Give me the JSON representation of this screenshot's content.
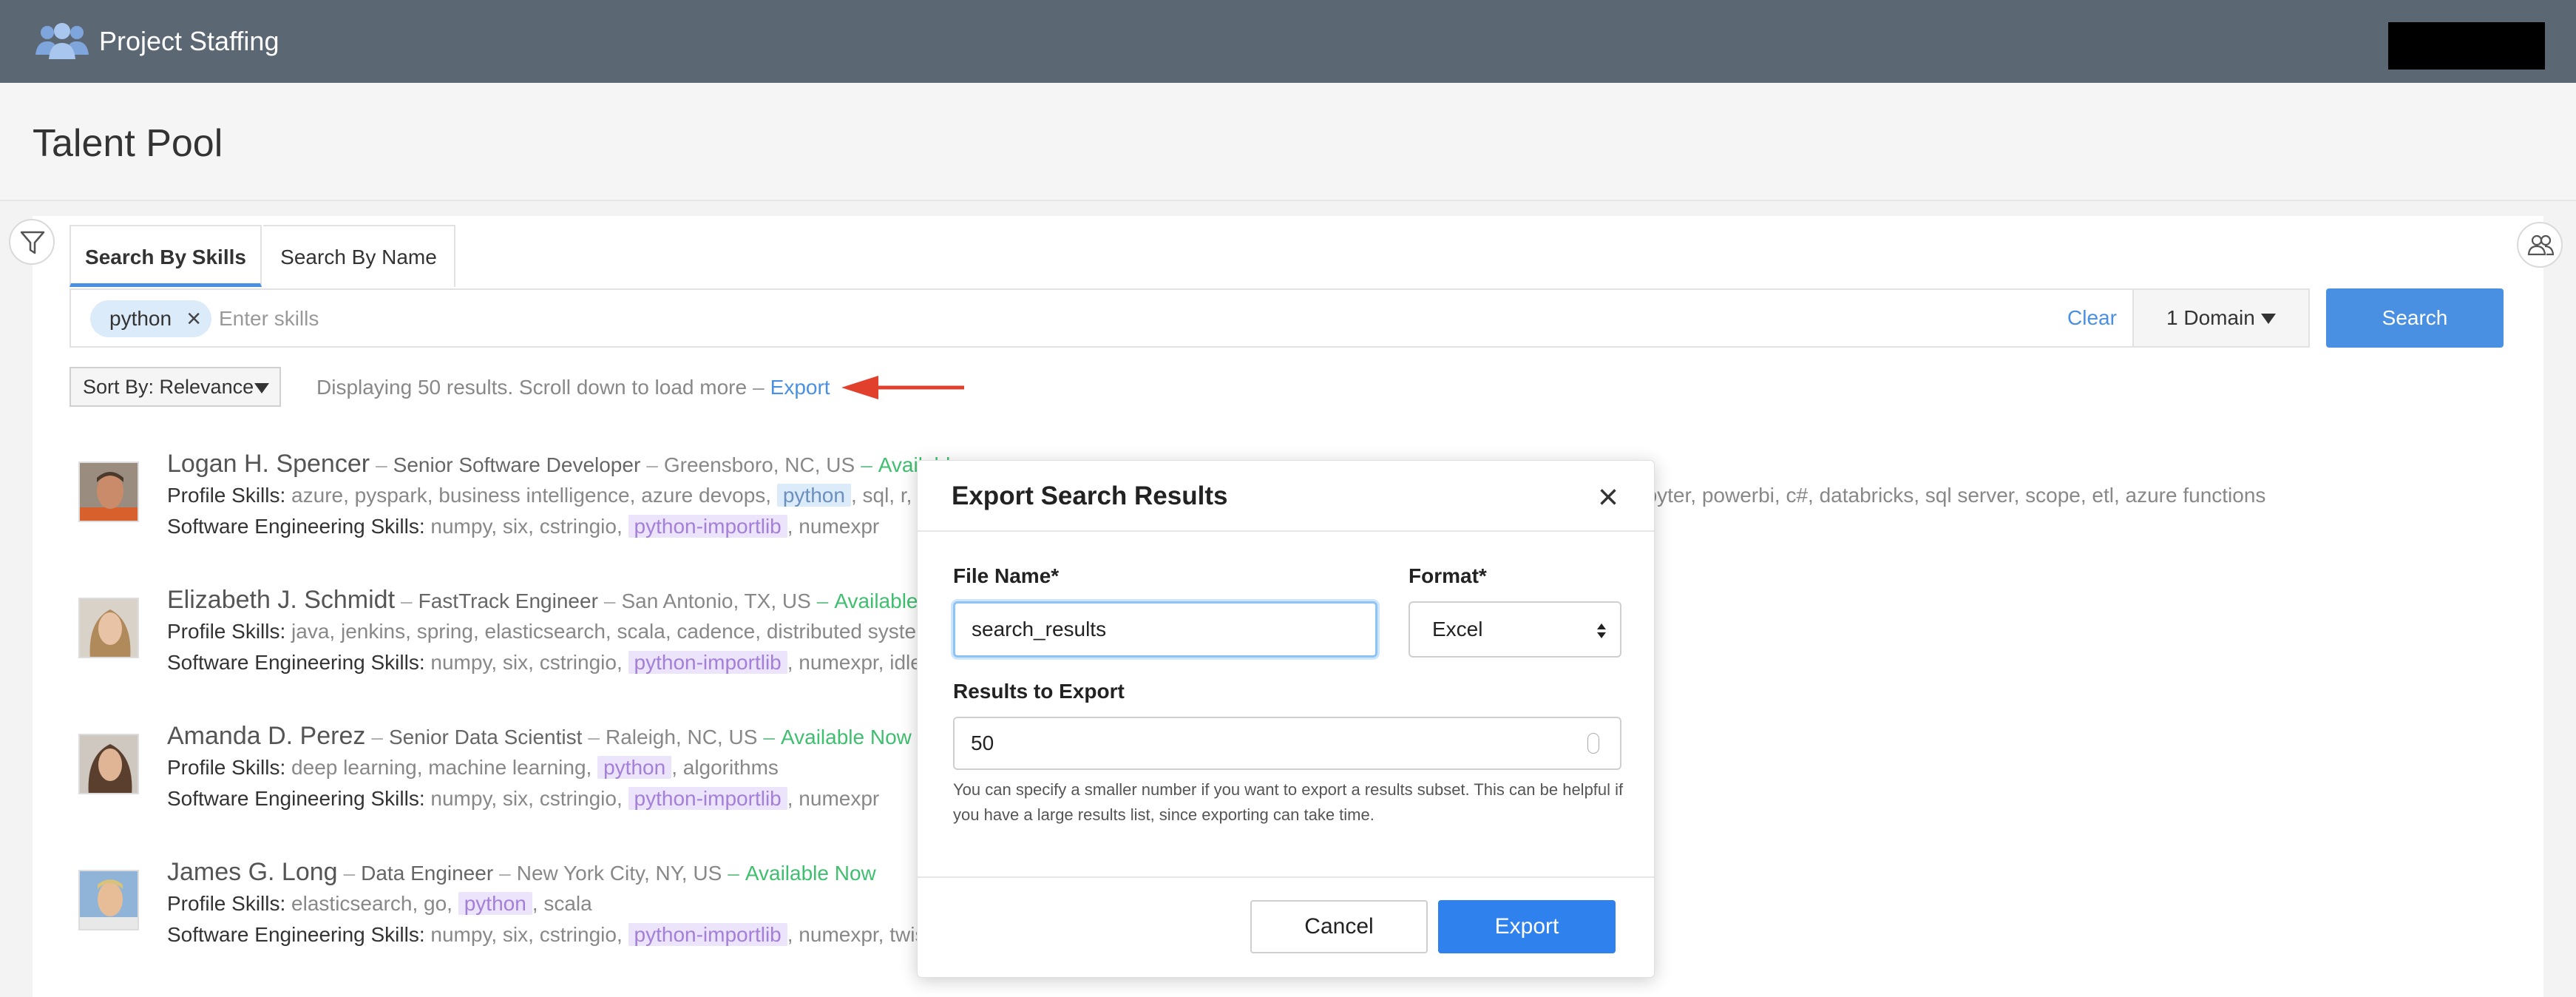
{
  "app": {
    "title": "Project Staffing"
  },
  "page": {
    "title": "Talent Pool"
  },
  "tabs": [
    {
      "label": "Search By Skills",
      "active": true
    },
    {
      "label": "Search By Name",
      "active": false
    }
  ],
  "search": {
    "chip": "python",
    "placeholder": "Enter skills",
    "clear_label": "Clear",
    "domain_label": "1 Domain",
    "search_label": "Search"
  },
  "results": {
    "sort_label": "Sort By: Relevance",
    "info": "Displaying 50 results. Scroll down to load more",
    "export_link": "Export"
  },
  "candidates": [
    {
      "name": "Logan H. Spencer",
      "role": "Senior Software Developer",
      "location": "Greensboro, NC, US",
      "availability": "Available ",
      "profile_label": "Profile Skills:",
      "profile_before": "azure, pyspark, business intelligence, azure devops,",
      "profile_tag": "python",
      "profile_after": ", sql, r, pow",
      "profile_right": "upyter, powerbi, c#, databricks, sql server, scope, etl, azure functions",
      "se_label": "Software Engineering Skills:",
      "se_before": "numpy, six, cstringio,",
      "se_tag": "python-importlib",
      "se_after": ", numexpr"
    },
    {
      "name": "Elizabeth J. Schmidt",
      "role": "FastTrack Engineer",
      "location": "San Antonio, TX, US",
      "availability": "Available si",
      "profile_label": "Profile Skills:",
      "profile_before": "java, jenkins, spring, elasticsearch, scala, cadence, distributed systems, z",
      "profile_tag": "",
      "profile_after": "",
      "se_label": "Software Engineering Skills:",
      "se_before": "numpy, six, cstringio,",
      "se_tag": "python-importlib",
      "se_after": ", numexpr, idle,"
    },
    {
      "name": "Amanda D. Perez",
      "role": "Senior Data Scientist",
      "location": "Raleigh, NC, US",
      "availability": "Available Now",
      "profile_label": "Profile Skills:",
      "profile_before": "deep learning, machine learning,",
      "profile_tag": "python",
      "profile_after": ", algorithms",
      "se_label": "Software Engineering Skills:",
      "se_before": "numpy, six, cstringio,",
      "se_tag": "python-importlib",
      "se_after": ", numexpr"
    },
    {
      "name": "James G. Long",
      "role": "Data Engineer",
      "location": "New York City, NY, US",
      "availability": "Available Now",
      "profile_label": "Profile Skills:",
      "profile_before": "elasticsearch, go,",
      "profile_tag": "python",
      "profile_after": ", scala",
      "se_label": "Software Engineering Skills:",
      "se_before": "numpy, six, cstringio,",
      "se_tag": "python-importlib",
      "se_after": ", numexpr, twist"
    }
  ],
  "modal": {
    "title": "Export Search Results",
    "close": "×",
    "file_label": "File Name*",
    "file_value": "search_results",
    "format_label": "Format*",
    "format_value": "Excel",
    "results_label": "Results to Export",
    "results_value": "50",
    "help": "You can specify a smaller number if you want to export a results subset. This can be helpful if you have a large results list, since exporting can take time.",
    "cancel": "Cancel",
    "export": "Export"
  },
  "colors": {
    "topbar": "#5c6774",
    "accent": "#4a90e2",
    "available": "#3fbf6f",
    "arrow": "#e0402c",
    "primary_button": "#2f82ee"
  }
}
